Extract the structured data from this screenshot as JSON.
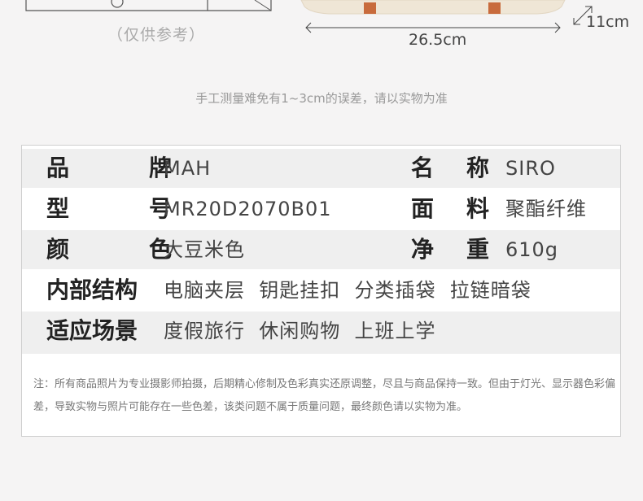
{
  "caption_left": "（仅供参考）",
  "dimension_width": "26.5cm",
  "dimension_depth": "11cm",
  "measure_note": "手工测量难免有1~3cm的误差，请以实物为准",
  "specs": {
    "brand_label_1": "品",
    "brand_label_2": "牌",
    "brand_value": "MAH",
    "name_label_1": "名",
    "name_label_2": "称",
    "name_value": "SIRO",
    "model_label_1": "型",
    "model_label_2": "号",
    "model_value": "MR20D2070B01",
    "material_label_1": "面",
    "material_label_2": "料",
    "material_value": "聚酯纤维",
    "color_label_1": "颜",
    "color_label_2": "色",
    "color_value": "大豆米色",
    "weight_label_1": "净",
    "weight_label_2": "重",
    "weight_value": "610g",
    "structure_label": "内部结构",
    "structure_value": "电脑夹层  钥匙挂扣  分类插袋  拉链暗袋",
    "scenario_label": "适应场景",
    "scenario_value": "度假旅行  休闲购物  上班上学"
  },
  "footnote": "注：所有商品照片为专业摄影师拍摄，后期精心修制及色彩真实还原调整，尽且与商品保持一致。但由于灯光、显示器色彩偏差，导致实物与照片可能存在一些色差，该类问题不属于质量问题，最终颜色请以实物为准。",
  "colors": {
    "background": "#f5f4f4",
    "strap": "#c86b3c",
    "bag_body": "#efe6d6"
  }
}
